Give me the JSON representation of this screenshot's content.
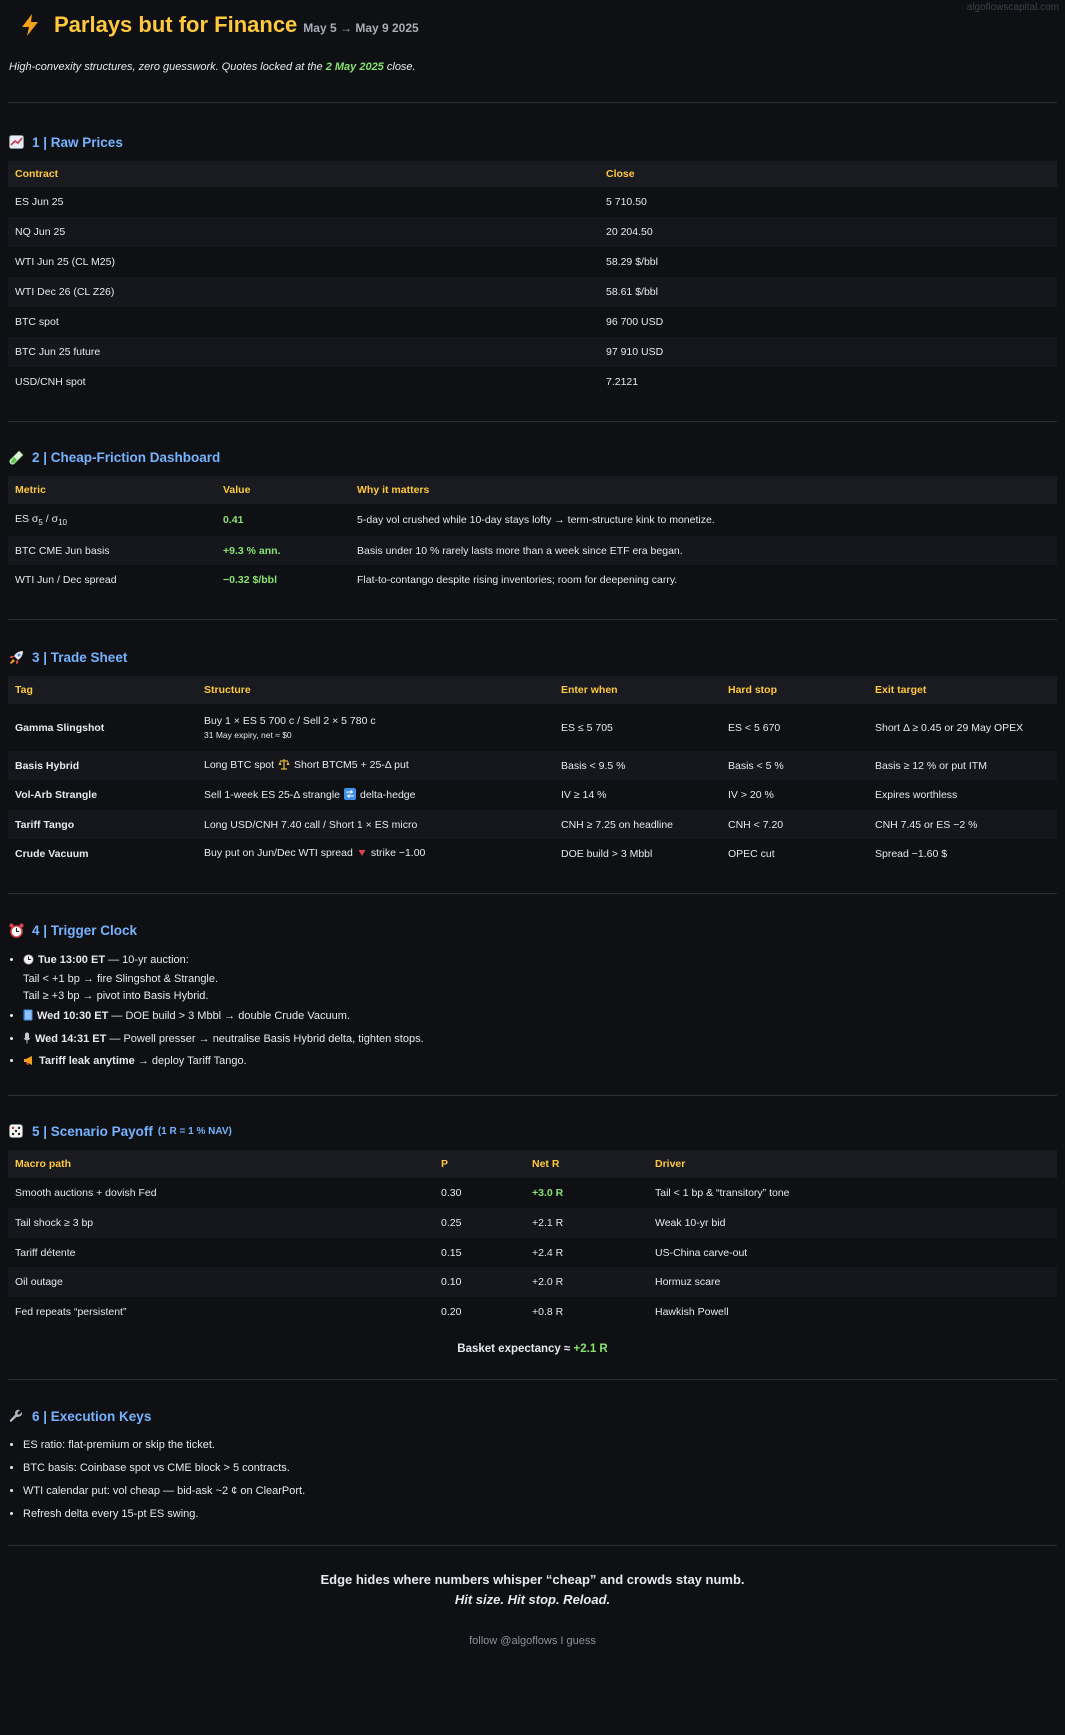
{
  "watermark": "algoflowscapital.com",
  "header": {
    "title": "Parlays but for Finance",
    "date_range": "May 5 → May 9 2025",
    "intro_before": "High-convexity structures, zero guesswork. Quotes locked at the ",
    "intro_highlight": "2 May 2025",
    "intro_after": " close."
  },
  "colors": {
    "background": "#0f1014",
    "accent_yellow": "#ffc83d",
    "heading_blue": "#74b3ff",
    "positive_green": "#86e36e"
  },
  "raw_prices": {
    "title": "1 | Raw Prices",
    "icon": "chart-increasing-icon",
    "columns": [
      "Contract",
      "Close"
    ],
    "rows": [
      [
        "ES Jun 25",
        "5 710.50"
      ],
      [
        "NQ Jun 25",
        "20 204.50"
      ],
      [
        "WTI Jun 25 (CL M25)",
        "58.29 $/bbl"
      ],
      [
        "WTI Dec 26 (CL Z26)",
        "58.61 $/bbl"
      ],
      [
        "BTC spot",
        "96 700 USD"
      ],
      [
        "BTC Jun 25 future",
        "97 910 USD"
      ],
      [
        "USD/CNH spot",
        "7.2121"
      ]
    ]
  },
  "dashboard": {
    "title": "2 | Cheap-Friction Dashboard",
    "icon": "test-tube-icon",
    "columns": [
      "Metric",
      "Value",
      "Why it matters"
    ],
    "rows": [
      {
        "metric": "ES σ5 / σ10",
        "value": "0.41",
        "why": "5-day vol crushed while 10-day stays lofty → term-structure kink to monetize."
      },
      {
        "metric": "BTC CME Jun basis",
        "value": "+9.3 % ann.",
        "why": "Basis under 10 % rarely lasts more than a week since ETF era began."
      },
      {
        "metric": "WTI Jun / Dec spread",
        "value": "−0.32 $/bbl",
        "why": "Flat-to-contango despite rising inventories; room for deepening carry."
      }
    ]
  },
  "trade_sheet": {
    "title": "3 | Trade Sheet",
    "icon": "rocket-icon",
    "columns": [
      "Tag",
      "Structure",
      "Enter when",
      "Hard stop",
      "Exit target"
    ],
    "rows": [
      {
        "tag": "Gamma Slingshot",
        "structure": "Buy 1 × ES 5 700 c / Sell 2 × 5 780 c",
        "structure_sub": "31 May expiry, net ≈ $0",
        "enter": "ES ≤ 5 705",
        "stop": "ES < 5 670",
        "exit": "Short Δ ≥ 0.45 or 29 May OPEX"
      },
      {
        "tag": "Basis Hybrid",
        "structure_a": "Long BTC spot",
        "structure_b": "Short BTCM5 + 25-Δ put",
        "enter": "Basis < 9.5 %",
        "stop": "Basis < 5 %",
        "exit": "Basis ≥ 12 % or put ITM"
      },
      {
        "tag": "Vol-Arb Strangle",
        "structure_a": "Sell 1-week ES 25-Δ strangle",
        "structure_b": "delta-hedge",
        "enter": "IV ≥ 14 %",
        "stop": "IV > 20 %",
        "exit": "Expires worthless"
      },
      {
        "tag": "Tariff Tango",
        "structure": "Long USD/CNH 7.40 call / Short 1 × ES micro",
        "enter": "CNH ≥ 7.25 on headline",
        "stop": "CNH < 7.20",
        "exit": "CNH 7.45 or ES −2 %"
      },
      {
        "tag": "Crude Vacuum",
        "structure_a": "Buy put on Jun/Dec WTI spread",
        "structure_b": "strike −1.00",
        "enter": "DOE build > 3 Mbbl",
        "stop": "OPEC cut",
        "exit": "Spread −1.60 $"
      }
    ]
  },
  "trigger_clock": {
    "title": "4 | Trigger Clock",
    "icon": "alarm-clock-icon",
    "items": [
      {
        "icon": "clock-icon",
        "time": "Tue 13:00 ET",
        "text": " — 10-yr auction:",
        "lines": [
          "Tail < +1 bp → fire Slingshot & Strangle.",
          "Tail ≥ +3 bp → pivot into Basis Hybrid."
        ]
      },
      {
        "icon": "book-icon",
        "time": "Wed 10:30 ET",
        "text": " — DOE build > 3 Mbbl → double Crude Vacuum."
      },
      {
        "icon": "microphone-icon",
        "time": "Wed 14:31 ET",
        "text": " — Powell presser → neutralise Basis Hybrid delta, tighten stops."
      },
      {
        "icon": "megaphone-icon",
        "time": "Tariff leak anytime",
        "text": " → deploy Tariff Tango."
      }
    ]
  },
  "scenario": {
    "title": "5 | Scenario Payoff",
    "title_note": "(1 R = 1 % NAV)",
    "icon": "dice-icon",
    "columns": [
      "Macro path",
      "P",
      "Net R",
      "Driver"
    ],
    "rows": [
      {
        "path": "Smooth auctions + dovish Fed",
        "p": "0.30",
        "r": "+3.0 R",
        "driver": "Tail < 1 bp & “transitory” tone",
        "highlight": true
      },
      {
        "path": "Tail shock ≥ 3 bp",
        "p": "0.25",
        "r": "+2.1 R",
        "driver": "Weak 10-yr bid"
      },
      {
        "path": "Tariff détente",
        "p": "0.15",
        "r": "+2.4 R",
        "driver": "US-China carve-out"
      },
      {
        "path": "Oil outage",
        "p": "0.10",
        "r": "+2.0 R",
        "driver": "Hormuz scare"
      },
      {
        "path": "Fed repeats “persistent”",
        "p": "0.20",
        "r": "+0.8 R",
        "driver": "Hawkish Powell"
      }
    ],
    "basket_label": "Basket expectancy ≈ ",
    "basket_value": "+2.1 R"
  },
  "execution": {
    "title": "6 | Execution Keys",
    "icon": "wrench-icon",
    "items": [
      "ES ratio: flat-premium or skip the ticket.",
      "BTC basis: Coinbase spot vs CME block > 5 contracts.",
      "WTI calendar put: vol cheap — bid-ask ~2 ¢ on ClearPort.",
      "Refresh delta every 15-pt ES swing."
    ]
  },
  "closing": {
    "line1": "Edge hides where numbers whisper “cheap” and crowds stay numb.",
    "line2": "Hit size. Hit stop. Reload."
  },
  "footer": "follow @algoflows I guess"
}
